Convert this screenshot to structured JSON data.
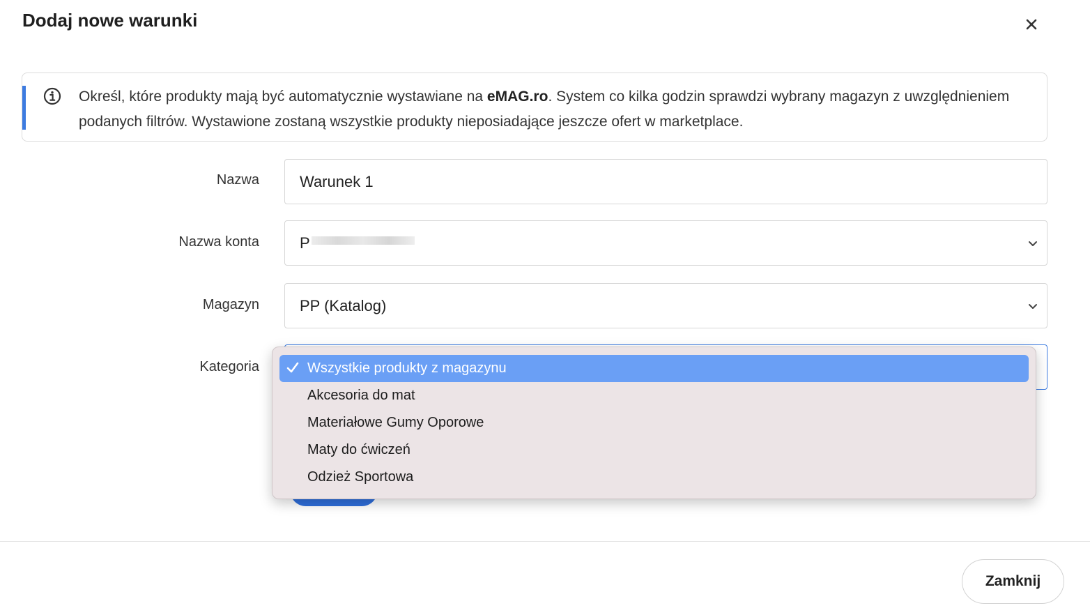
{
  "modal": {
    "title": "Dodaj nowe warunki",
    "close_icon": "close-icon"
  },
  "info": {
    "icon": "info-icon",
    "text_before": "Określ, które produkty mają być automatycznie wystawiane na ",
    "highlight": "eMAG.ro",
    "text_after": ". System co kilka godzin sprawdzi wybrany magazyn z uwzględnieniem podanych filtrów. Wystawione zostaną wszystkie produkty nieposiadające jeszcze ofert w marketplace."
  },
  "form": {
    "name": {
      "label": "Nazwa",
      "value": "Warunek 1"
    },
    "account": {
      "label": "Nazwa konta",
      "value": "P"
    },
    "warehouse": {
      "label": "Magazyn",
      "value": "PP (Katalog)"
    },
    "category": {
      "label": "Kategoria",
      "options": [
        "Wszystkie produkty z magazynu",
        "Akcesoria do mat",
        "Materiałowe Gumy Oporowe",
        "Maty do ćwiczeń",
        "Odzież Sportowa"
      ],
      "selected": "Wszystkie produkty z magazynu"
    }
  },
  "footer": {
    "close_label": "Zamknij"
  },
  "colors": {
    "accent": "#3d7be0",
    "dropdown_selected": "#6a9ff5",
    "dropdown_bg": "#ece4e6"
  }
}
